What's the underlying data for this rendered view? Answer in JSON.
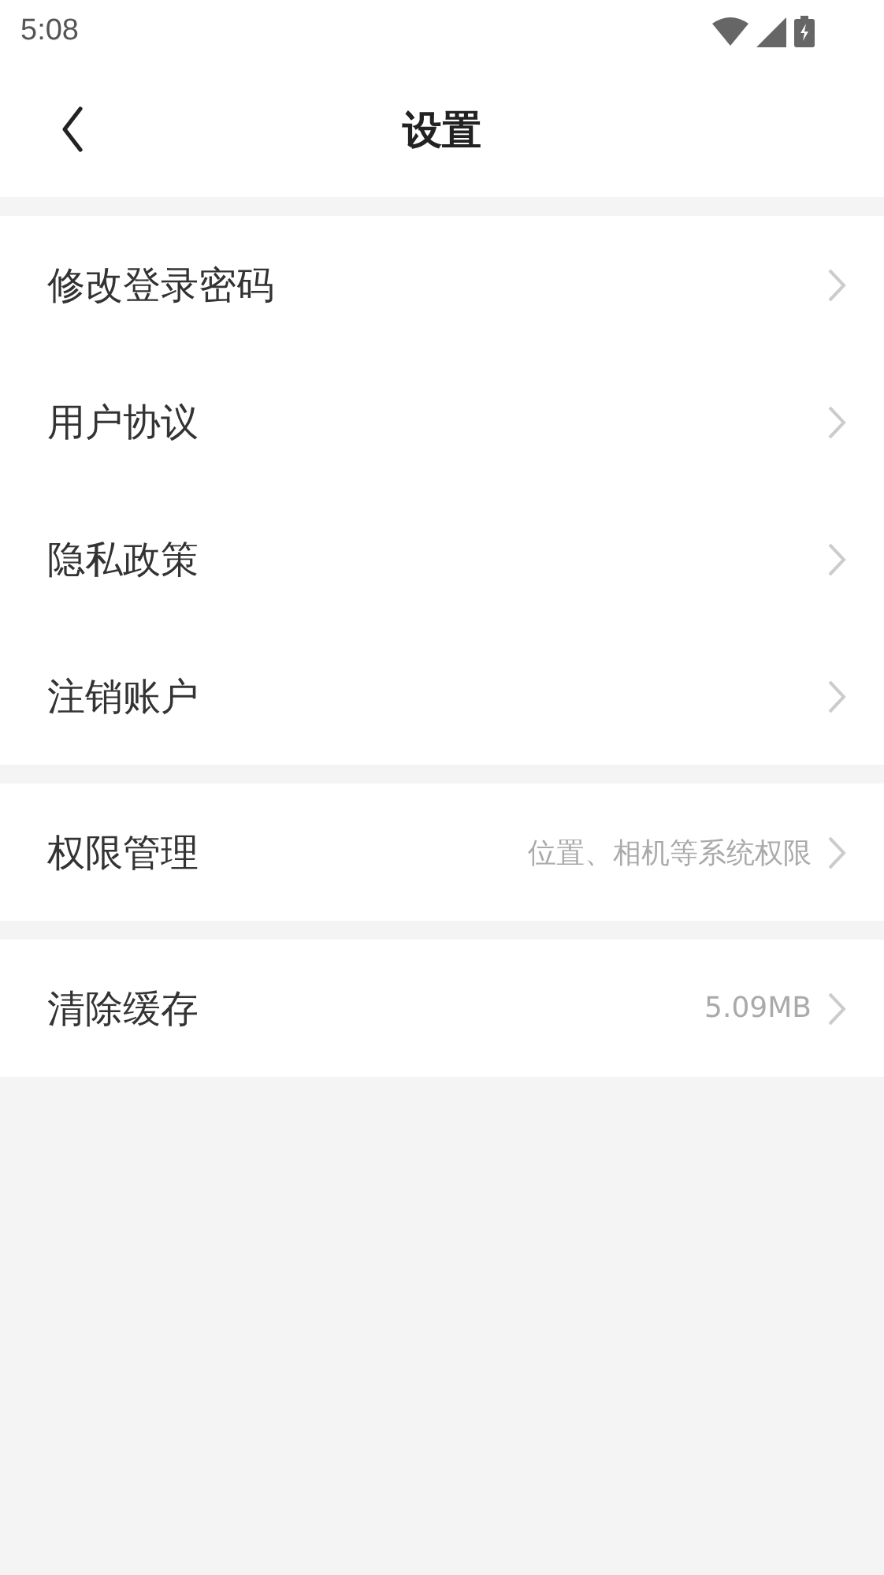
{
  "status_bar": {
    "time": "5:08"
  },
  "header": {
    "title": "设置"
  },
  "groups": [
    {
      "items": [
        {
          "label": "修改登录密码"
        },
        {
          "label": "用户协议"
        },
        {
          "label": "隐私政策"
        },
        {
          "label": "注销账户"
        }
      ]
    },
    {
      "items": [
        {
          "label": "权限管理",
          "value": "位置、相机等系统权限"
        }
      ]
    },
    {
      "items": [
        {
          "label": "清除缓存",
          "value": "5.09MB"
        }
      ]
    }
  ]
}
